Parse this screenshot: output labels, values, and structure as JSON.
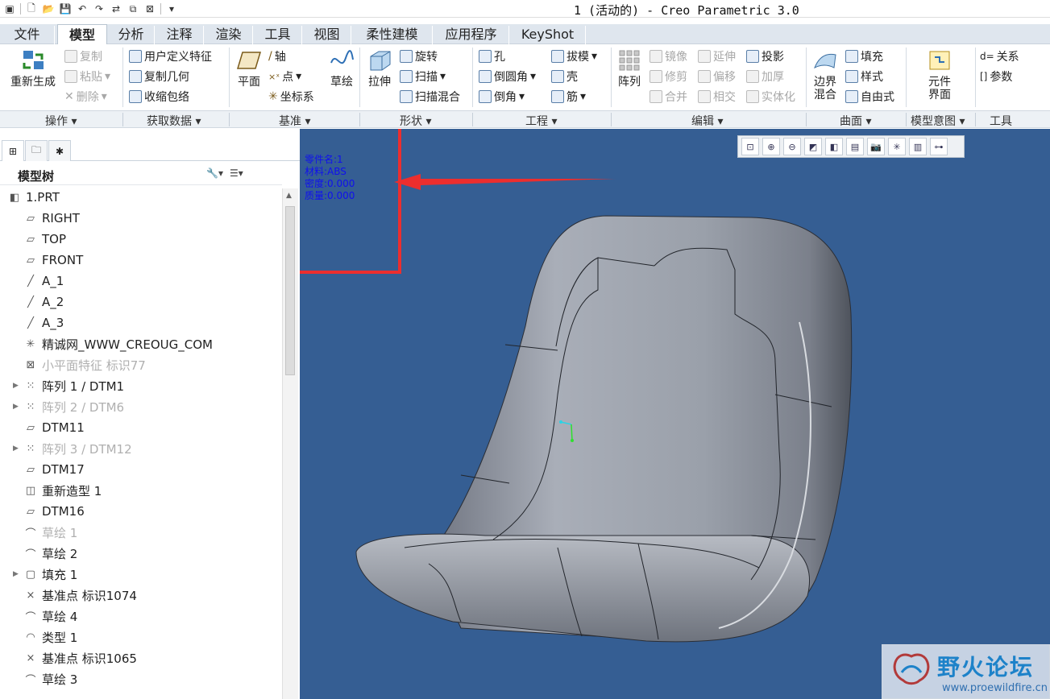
{
  "window": {
    "title": "1 (活动的) - Creo Parametric 3.0"
  },
  "tabs": [
    {
      "label": "文件"
    },
    {
      "label": "模型"
    },
    {
      "label": "分析"
    },
    {
      "label": "注释"
    },
    {
      "label": "渲染"
    },
    {
      "label": "工具"
    },
    {
      "label": "视图"
    },
    {
      "label": "柔性建模"
    },
    {
      "label": "应用程序"
    },
    {
      "label": "KeyShot"
    }
  ],
  "ribbon": {
    "operations": {
      "regenerate": "重新生成",
      "copy": "复制",
      "paste": "粘贴",
      "delete": "删除"
    },
    "get_data": {
      "udf": "用户定义特征",
      "copy_geom": "复制几何",
      "shrinkwrap": "收缩包络"
    },
    "datum": {
      "plane": "平面",
      "axis": "轴",
      "point": "点",
      "csys": "坐标系",
      "sketch": "草绘"
    },
    "shapes": {
      "extrude": "拉伸",
      "revolve": "旋转",
      "sweep": "扫描",
      "swept_blend": "扫描混合"
    },
    "engineering": {
      "hole": "孔",
      "round": "倒圆角",
      "chamfer": "倒角",
      "draft": "拔模",
      "shell": "壳",
      "rib": "筋"
    },
    "editing": {
      "pattern": "阵列",
      "mirror": "镜像",
      "trim": "修剪",
      "merge": "合并",
      "extend": "延伸",
      "offset": "偏移",
      "intersect": "相交",
      "project": "投影",
      "thicken": "加厚",
      "solidify": "实体化"
    },
    "surfaces": {
      "boundary_blend": "边界\n混合",
      "fill": "填充",
      "style": "样式",
      "freestyle": "自由式"
    },
    "model_intent": {
      "component_interface": "元件\n界面"
    },
    "tools": {
      "relations": "关系",
      "parameters": "参数"
    }
  },
  "groups": {
    "operations": "操作",
    "get_data": "获取数据",
    "datum": "基准",
    "shapes": "形状",
    "engineering": "工程",
    "editing": "编辑",
    "surfaces": "曲面",
    "model_intent": "模型意图",
    "tools": "工具"
  },
  "model_tree": {
    "title": "模型树",
    "items": [
      {
        "label": "1.PRT",
        "icon": "part-icon",
        "expandable": false,
        "dim": false
      },
      {
        "label": "RIGHT",
        "icon": "datum-plane-icon",
        "expandable": false,
        "dim": false
      },
      {
        "label": "TOP",
        "icon": "datum-plane-icon",
        "expandable": false,
        "dim": false
      },
      {
        "label": "FRONT",
        "icon": "datum-plane-icon",
        "expandable": false,
        "dim": false
      },
      {
        "label": "A_1",
        "icon": "datum-axis-icon",
        "expandable": false,
        "dim": false
      },
      {
        "label": "A_2",
        "icon": "datum-axis-icon",
        "expandable": false,
        "dim": false
      },
      {
        "label": "A_3",
        "icon": "datum-axis-icon",
        "expandable": false,
        "dim": false
      },
      {
        "label": "精诚网_WWW_CREOUG_COM",
        "icon": "csys-icon",
        "expandable": false,
        "dim": false
      },
      {
        "label": "小平面特征 标识77",
        "icon": "facet-icon",
        "expandable": false,
        "dim": true
      },
      {
        "label": "阵列 1 / DTM1",
        "icon": "pattern-icon",
        "expandable": true,
        "dim": false
      },
      {
        "label": "阵列 2 / DTM6",
        "icon": "pattern-icon",
        "expandable": true,
        "dim": true
      },
      {
        "label": "DTM11",
        "icon": "datum-plane-icon",
        "expandable": false,
        "dim": false
      },
      {
        "label": "阵列 3 / DTM12",
        "icon": "pattern-icon",
        "expandable": true,
        "dim": true
      },
      {
        "label": "DTM17",
        "icon": "datum-plane-icon",
        "expandable": false,
        "dim": false
      },
      {
        "label": "重新造型 1",
        "icon": "restyle-icon",
        "expandable": false,
        "dim": false
      },
      {
        "label": "DTM16",
        "icon": "datum-plane-icon",
        "expandable": false,
        "dim": false
      },
      {
        "label": "草绘 1",
        "icon": "sketch-icon",
        "expandable": false,
        "dim": true
      },
      {
        "label": "草绘 2",
        "icon": "sketch-icon",
        "expandable": false,
        "dim": false
      },
      {
        "label": "填充 1",
        "icon": "fill-icon",
        "expandable": true,
        "dim": false
      },
      {
        "label": "基准点 标识1074",
        "icon": "datum-point-icon",
        "expandable": false,
        "dim": false
      },
      {
        "label": "草绘 4",
        "icon": "sketch-icon",
        "expandable": false,
        "dim": false
      },
      {
        "label": "类型 1",
        "icon": "style-icon",
        "expandable": false,
        "dim": false
      },
      {
        "label": "基准点 标识1065",
        "icon": "datum-point-icon",
        "expandable": false,
        "dim": false
      },
      {
        "label": "草绘 3",
        "icon": "sketch-icon",
        "expandable": false,
        "dim": false
      }
    ]
  },
  "viewport": {
    "info_lines": [
      "零件名:1",
      "材料:ABS",
      "密度:0.000",
      "质量:0.000"
    ],
    "background_color": "#355e93",
    "watermark": {
      "title": "野火论坛",
      "url": "www.proewildfire.cn"
    }
  },
  "colors": {
    "accent_red": "#ec2e2e",
    "info_text": "#1010ee"
  }
}
